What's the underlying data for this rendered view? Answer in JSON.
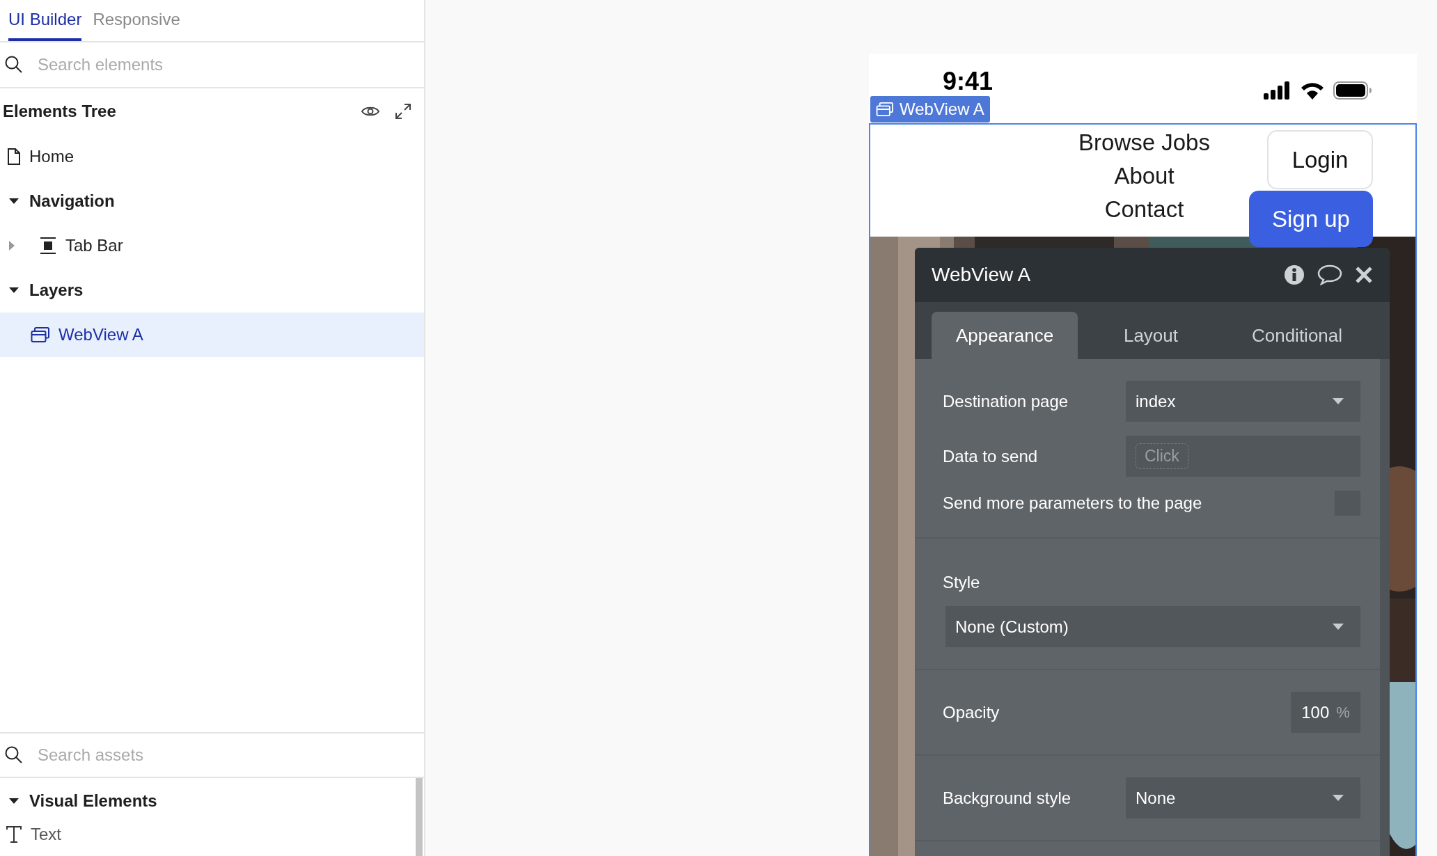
{
  "left_panel": {
    "tabs": [
      {
        "label": "UI Builder",
        "selected": true
      },
      {
        "label": "Responsive",
        "selected": false
      }
    ],
    "search": {
      "placeholder": "Search elements"
    },
    "elements_tree": {
      "title": "Elements Tree",
      "items": [
        {
          "label": "Home",
          "kind": "page",
          "selected": false
        },
        {
          "label": "Navigation",
          "kind": "group",
          "expanded": true,
          "selected": false,
          "children": [
            {
              "label": "Tab Bar",
              "kind": "tabbar",
              "expanded": false,
              "selected": false
            }
          ]
        },
        {
          "label": "Layers",
          "kind": "group",
          "expanded": true,
          "selected": false,
          "children": [
            {
              "label": "WebView A",
              "kind": "webview",
              "selected": true
            }
          ]
        }
      ]
    },
    "assets": {
      "search": {
        "placeholder": "Search assets"
      },
      "groups": [
        {
          "label": "Visual Elements",
          "expanded": true,
          "items": [
            {
              "label": "Text",
              "kind": "text"
            }
          ]
        }
      ]
    }
  },
  "phone": {
    "time": "9:41",
    "element_badge": "WebView A",
    "nav_links": [
      "Browse Jobs",
      "About",
      "Contact"
    ],
    "login_button": "Login",
    "signup_button": "Sign up"
  },
  "property_editor": {
    "title": "WebView A",
    "tabs": [
      {
        "label": "Appearance",
        "selected": true
      },
      {
        "label": "Layout",
        "selected": false
      },
      {
        "label": "Conditional",
        "selected": false
      }
    ],
    "sections": [
      [
        {
          "kind": "dropdown",
          "label": "Destination page",
          "value": "index"
        },
        {
          "kind": "dynamic",
          "label": "Data to send",
          "placeholder": "Click"
        },
        {
          "kind": "checkbox",
          "label": "Send more parameters to the page",
          "checked": false
        }
      ],
      [
        {
          "kind": "stacked_dropdown",
          "label": "Style",
          "value": "None (Custom)"
        }
      ],
      [
        {
          "kind": "number",
          "label": "Opacity",
          "value": "100",
          "unit": "%"
        }
      ],
      [
        {
          "kind": "dropdown",
          "label": "Background style",
          "value": "None"
        }
      ]
    ]
  }
}
